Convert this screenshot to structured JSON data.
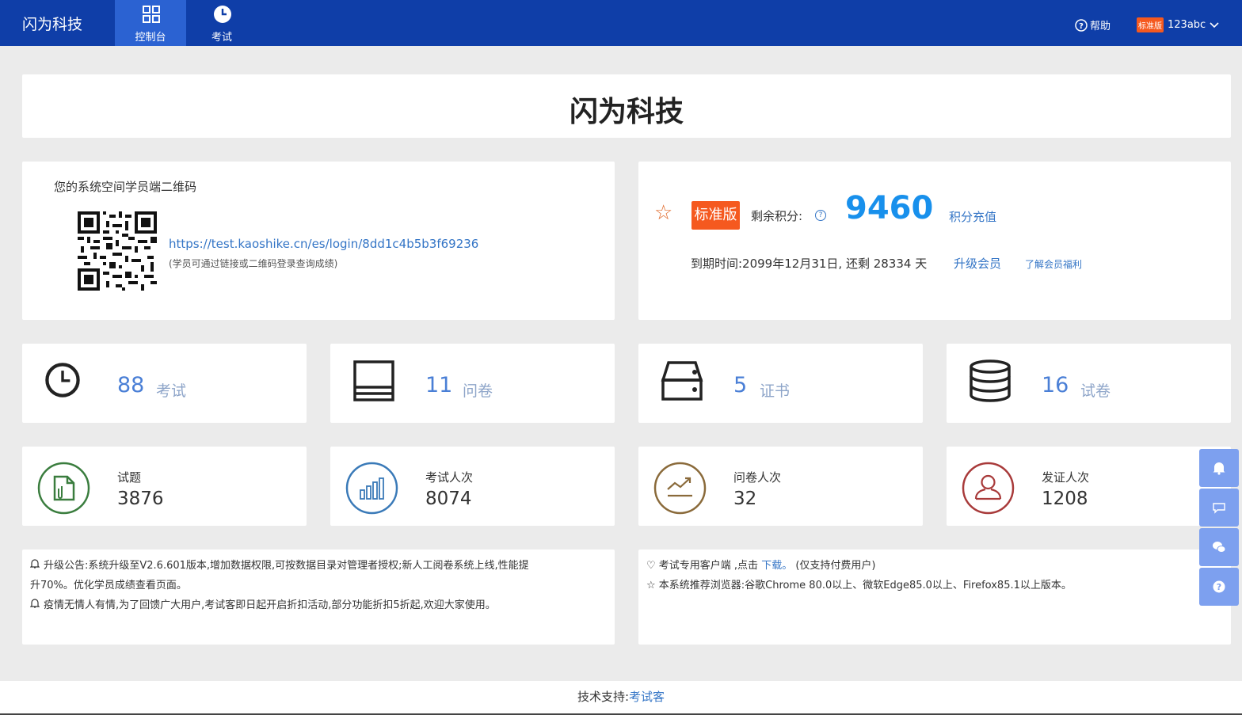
{
  "header": {
    "brand": "闪为科技",
    "nav": [
      {
        "label": "控制台",
        "icon": "grid-icon",
        "active": true
      },
      {
        "label": "考试",
        "icon": "clock-icon",
        "active": false
      }
    ],
    "help_label": "帮助",
    "edition_badge": "标准版",
    "username": "123abc"
  },
  "title": "闪为科技",
  "qr_section": {
    "title": "您的系统空间学员端二维码",
    "link": "https://test.kaoshike.cn/es/login/8dd1c4b5b3f69236",
    "note": "(学员可通过链接或二维码登录查询成绩)"
  },
  "membership": {
    "badge": "标准版",
    "points_label": "剩余积分:",
    "points_value": "9460",
    "recharge_label": "积分充值",
    "expire_text": "到期时间:2099年12月31日, 还剩 28334 天",
    "upgrade_label": "升级会员",
    "benefit_label": "了解会员福利"
  },
  "stats": [
    {
      "num": "88",
      "unit": "考试",
      "icon": "clock-icon"
    },
    {
      "num": "11",
      "unit": "问卷",
      "icon": "layers-icon"
    },
    {
      "num": "5",
      "unit": "证书",
      "icon": "server-icon"
    },
    {
      "num": "16",
      "unit": "试卷",
      "icon": "database-icon"
    }
  ],
  "metrics": [
    {
      "label": "试题",
      "value": "3876",
      "icon": "file-icon",
      "color": "#3a7d3e"
    },
    {
      "label": "考试人次",
      "value": "8074",
      "icon": "bar-chart-icon",
      "color": "#3a7ab8"
    },
    {
      "label": "问卷人次",
      "value": "32",
      "icon": "trend-icon",
      "color": "#8a6a3a"
    },
    {
      "label": "发证人次",
      "value": "1208",
      "icon": "user-icon",
      "color": "#a83a3a"
    }
  ],
  "notices": [
    "升级公告:系统升级至V2.6.601版本,增加数据权限,可按数据目录对管理者授权;新人工阅卷系统上线,性能提",
    "升70%。优化学员成绩查看页面。",
    "疫情无情人有情,为了回馈广大用户,考试客即日起开启折扣活动,部分功能折扣5折起,欢迎大家使用。"
  ],
  "client": {
    "line1_prefix": "考试专用客户端 ,点击",
    "download_label": "下载。",
    "line1_suffix": "(仅支持付费用户)",
    "line2": "本系统推荐浏览器:谷歌Chrome 80.0以上、微软Edge85.0以上、Firefox85.1以上版本。"
  },
  "footer": {
    "prefix": "技术支持:",
    "link": "考试客"
  },
  "colors": {
    "nav_bg": "#0f3ea8",
    "accent": "#1890ec",
    "badge": "#f5591f"
  }
}
